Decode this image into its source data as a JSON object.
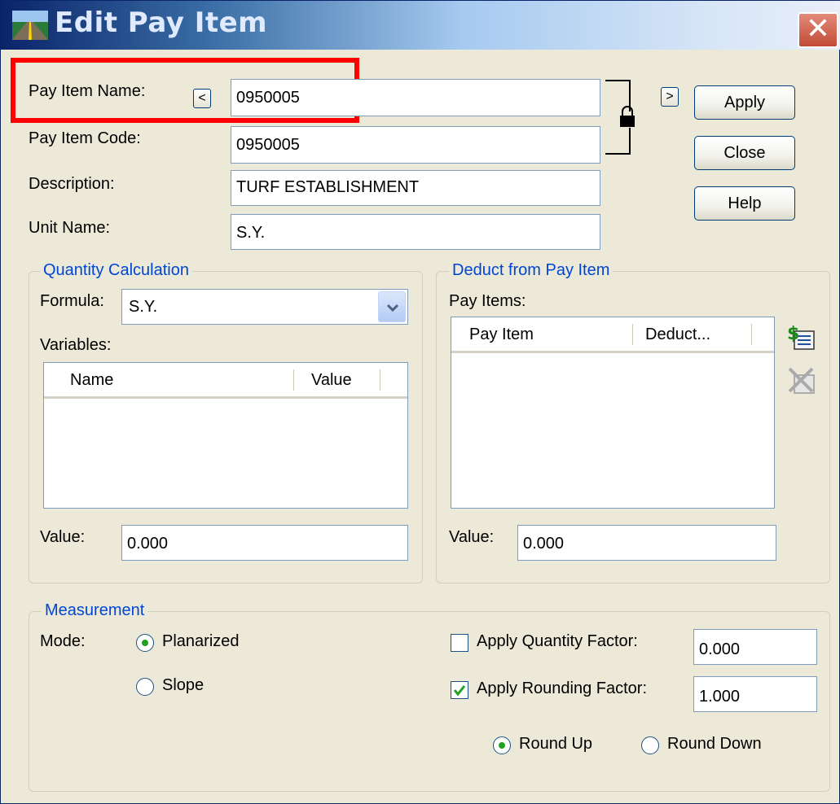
{
  "window": {
    "title": "Edit Pay Item"
  },
  "fields": {
    "pay_item_name": {
      "label": "Pay Item Name:",
      "value": "0950005"
    },
    "pay_item_code": {
      "label": "Pay Item Code:",
      "value": "0950005"
    },
    "description": {
      "label": "Description:",
      "value": "TURF ESTABLISHMENT"
    },
    "unit_name": {
      "label": "Unit Name:",
      "value": "S.Y."
    }
  },
  "nav": {
    "prev": "<",
    "next": ">"
  },
  "buttons": {
    "apply": "Apply",
    "close": "Close",
    "help": "Help"
  },
  "quantity_calculation": {
    "title": "Quantity Calculation",
    "formula_label": "Formula:",
    "formula_value": "S.Y.",
    "variables_label": "Variables:",
    "columns": [
      "Name",
      "Value"
    ],
    "rows": [],
    "value_label": "Value:",
    "value": "0.000"
  },
  "deduct": {
    "title": "Deduct from Pay Item",
    "pay_items_label": "Pay Items:",
    "columns": [
      "Pay Item",
      "Deduct..."
    ],
    "rows": [],
    "value_label": "Value:",
    "value": "0.000"
  },
  "measurement": {
    "title": "Measurement",
    "mode_label": "Mode:",
    "mode_options": [
      "Planarized",
      "Slope"
    ],
    "mode_selected": "Planarized",
    "apply_quantity_factor": {
      "label": "Apply Quantity Factor:",
      "checked": false,
      "value": "0.000"
    },
    "apply_rounding_factor": {
      "label": "Apply Rounding Factor:",
      "checked": true,
      "value": "1.000"
    },
    "rounding_options": [
      "Round Up",
      "Round Down"
    ],
    "rounding_selected": "Round Up"
  },
  "colors": {
    "highlight": "#ff0000",
    "group_title": "#0046d5",
    "title_bar": "#0a246a"
  }
}
